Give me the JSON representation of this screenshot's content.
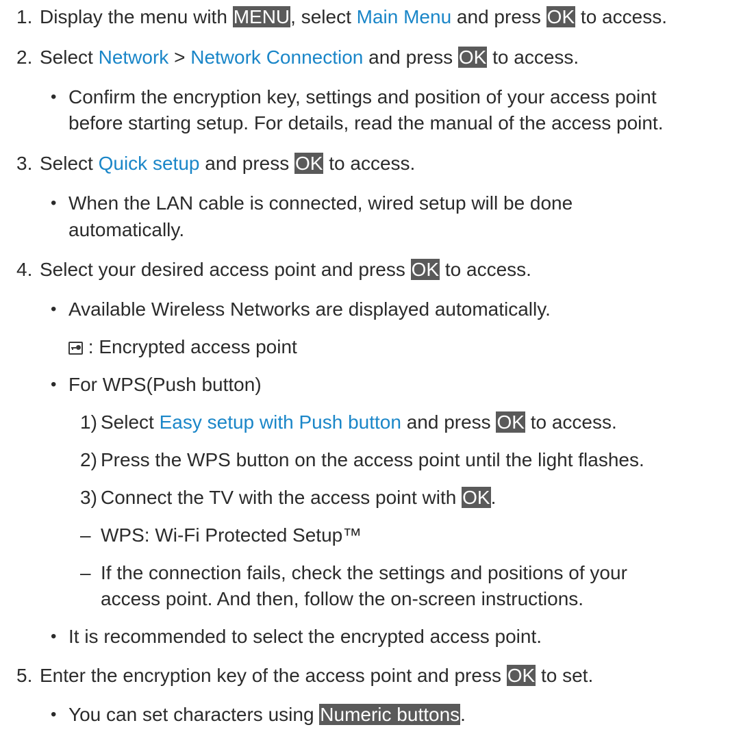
{
  "steps": {
    "s1": {
      "num": "1.",
      "t1": "Display the menu with ",
      "k1": "MENU",
      "t2": ", select ",
      "l1": "Main Menu",
      "t3": " and press ",
      "k2": "OK",
      "t4": " to access."
    },
    "s2": {
      "num": "2.",
      "t1": "Select ",
      "l1": "Network",
      "t2": " > ",
      "l2": "Network Connection",
      "t3": " and press ",
      "k1": "OK",
      "t4": " to access."
    },
    "s2_bullet": {
      "line1": "Confirm the encryption key, settings and position of your access point",
      "line2": "before starting setup. For details, read the manual of the access point."
    },
    "s3": {
      "num": "3.",
      "t1": "Select ",
      "l1": "Quick setup",
      "t2": " and press ",
      "k1": "OK",
      "t3": " to access."
    },
    "s3_bullet": {
      "line1": "When the LAN cable is connected, wired setup will be done",
      "line2": "automatically."
    },
    "s4": {
      "num": "4.",
      "t1": "Select your desired access point and press ",
      "k1": "OK",
      "t2": " to access."
    },
    "s4_bullet1": "Available Wireless Networks are displayed automatically.",
    "s4_icon_text": " : Encrypted access point",
    "s4_bullet2": "For WPS(Push button)",
    "s4_sub1": {
      "num": "1)",
      "t1": "Select ",
      "l1": "Easy setup with Push button",
      "t2": " and press ",
      "k1": "OK",
      "t3": " to access."
    },
    "s4_sub2": {
      "num": "2)",
      "text": "Press the WPS button on the access point until the light flashes."
    },
    "s4_sub3": {
      "num": "3)",
      "t1": "Connect the TV with the access point with ",
      "k1": "OK",
      "t2": "."
    },
    "s4_dash1": "WPS: Wi-Fi Protected Setup™",
    "s4_dash2": {
      "line1": "If the connection fails, check the settings and positions of your",
      "line2": "access point. And then, follow the on-screen instructions."
    },
    "s4_bullet3": "It is recommended to select the encrypted access point.",
    "s5": {
      "num": "5.",
      "t1": "Enter the encryption key of the access point and press ",
      "k1": "OK",
      "t2": " to set."
    },
    "s5_bullet": {
      "t1": "You can set characters using ",
      "k1": "Numeric buttons",
      "t2": "."
    },
    "symbols": {
      "bullet": "•",
      "dash": "–"
    },
    "colors": {
      "link": "#1a86c8",
      "key_bg": "#5a5a5a",
      "key_fg": "#ffffff",
      "text": "#2b2b2b"
    }
  }
}
